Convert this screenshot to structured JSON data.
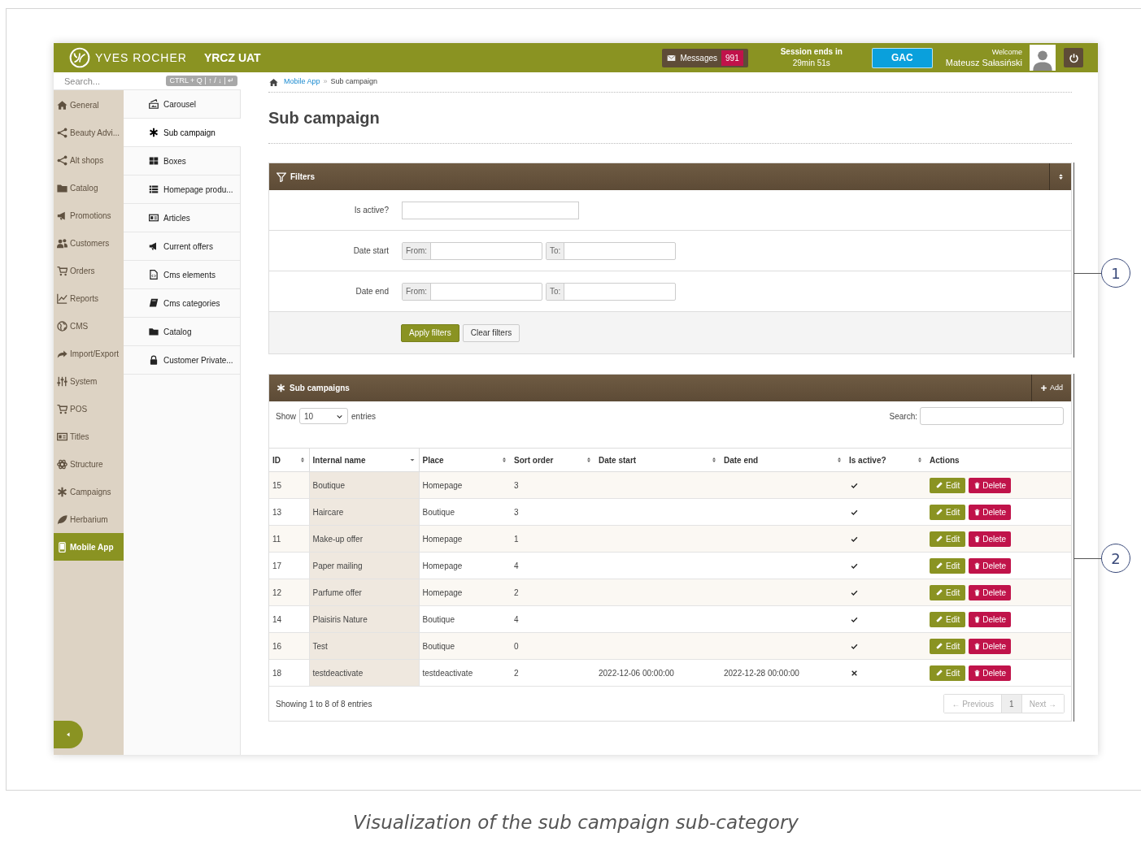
{
  "header": {
    "brand": "YVES ROCHER",
    "env": "YRCZ UAT",
    "messages": {
      "label": "Messages",
      "count": "991"
    },
    "session": {
      "label": "Session ends in",
      "time": "29min 51s"
    },
    "gac": "GAC",
    "welcome": "Welcome",
    "user": "Mateusz Sałasiński"
  },
  "search": {
    "placeholder": "Search...",
    "shortcut": "CTRL + Q | ↑ / ↓ | ↵"
  },
  "sidebar": {
    "items": [
      {
        "label": "General",
        "selected": false
      },
      {
        "label": "Beauty Advi...",
        "selected": false
      },
      {
        "label": "Alt shops",
        "selected": false
      },
      {
        "label": "Catalog",
        "selected": false
      },
      {
        "label": "Promotions",
        "selected": false
      },
      {
        "label": "Customers",
        "selected": false
      },
      {
        "label": "Orders",
        "selected": false
      },
      {
        "label": "Reports",
        "selected": false
      },
      {
        "label": "CMS",
        "selected": false
      },
      {
        "label": "Import/Export",
        "selected": false
      },
      {
        "label": "System",
        "selected": false
      },
      {
        "label": "POS",
        "selected": false
      },
      {
        "label": "Titles",
        "selected": false
      },
      {
        "label": "Structure",
        "selected": false
      },
      {
        "label": "Campaigns",
        "selected": false
      },
      {
        "label": "Herbarium",
        "selected": false
      },
      {
        "label": "Mobile App",
        "selected": true
      }
    ]
  },
  "submenu": {
    "items": [
      {
        "label": "Carousel",
        "selected": false
      },
      {
        "label": "Sub campaign",
        "selected": true
      },
      {
        "label": "Boxes",
        "selected": false
      },
      {
        "label": "Homepage produ...",
        "selected": false
      },
      {
        "label": "Articles",
        "selected": false
      },
      {
        "label": "Current offers",
        "selected": false
      },
      {
        "label": "Cms elements",
        "selected": false
      },
      {
        "label": "Cms categories",
        "selected": false
      },
      {
        "label": "Catalog",
        "selected": false
      },
      {
        "label": "Customer Private...",
        "selected": false
      }
    ]
  },
  "breadcrumb": {
    "items": [
      "Mobile App",
      "Sub campaign"
    ],
    "separator": "»"
  },
  "page_title": "Sub campaign",
  "filters": {
    "title": "Filters",
    "fields": [
      {
        "label": "Is active?",
        "kind": "text"
      },
      {
        "label": "Date start",
        "kind": "range",
        "from": "From:",
        "to": "To:"
      },
      {
        "label": "Date end",
        "kind": "range",
        "from": "From:",
        "to": "To:"
      }
    ],
    "apply": "Apply filters",
    "clear": "Clear filters"
  },
  "table_panel": {
    "title": "Sub campaigns",
    "add": "Add",
    "show": "Show",
    "page_size": "10",
    "entries": "entries",
    "search": "Search:",
    "columns": [
      {
        "label": "ID",
        "sortable": true,
        "sorted": false
      },
      {
        "label": "Internal name",
        "sortable": true,
        "sorted": true
      },
      {
        "label": "Place",
        "sortable": true,
        "sorted": false
      },
      {
        "label": "Sort order",
        "sortable": true,
        "sorted": false
      },
      {
        "label": "Date start",
        "sortable": true,
        "sorted": false
      },
      {
        "label": "Date end",
        "sortable": true,
        "sorted": false
      },
      {
        "label": "Is active?",
        "sortable": true,
        "sorted": false
      },
      {
        "label": "Actions",
        "sortable": false,
        "sorted": false
      }
    ],
    "rows": [
      {
        "id": "15",
        "name": "Boutique",
        "place": "Homepage",
        "sort": "3",
        "active": true,
        "edit": "Edit",
        "delete": "Delete"
      },
      {
        "id": "13",
        "name": "Haircare",
        "place": "Boutique",
        "sort": "3",
        "active": true,
        "edit": "Edit",
        "delete": "Delete"
      },
      {
        "id": "11",
        "name": "Make-up offer",
        "place": "Homepage",
        "sort": "1",
        "active": true,
        "edit": "Edit",
        "delete": "Delete"
      },
      {
        "id": "17",
        "name": "Paper mailing",
        "place": "Homepage",
        "sort": "4",
        "active": true,
        "edit": "Edit",
        "delete": "Delete"
      },
      {
        "id": "12",
        "name": "Parfume offer",
        "place": "Homepage",
        "sort": "2",
        "active": true,
        "edit": "Edit",
        "delete": "Delete"
      },
      {
        "id": "14",
        "name": "Plaisiris Nature",
        "place": "Boutique",
        "sort": "4",
        "active": true,
        "edit": "Edit",
        "delete": "Delete"
      },
      {
        "id": "16",
        "name": "Test",
        "place": "Boutique",
        "sort": "0",
        "active": true,
        "edit": "Edit",
        "delete": "Delete"
      },
      {
        "id": "18",
        "name": "testdeactivate",
        "place": "testdeactivate",
        "sort": "2",
        "start": "2022-12-06 00:00:00",
        "end": "2022-12-28 00:00:00",
        "active": false,
        "edit": "Edit",
        "delete": "Delete"
      }
    ],
    "info": "Showing 1 to 8 of 8 entries",
    "pagination": [
      {
        "label": "← Previous",
        "selected": false,
        "disabled": true
      },
      {
        "label": "1",
        "selected": true,
        "disabled": false
      },
      {
        "label": "Next →",
        "selected": false,
        "disabled": true
      }
    ]
  },
  "callouts": [
    "1",
    "2"
  ],
  "caption": "Visualization of the sub campaign sub-category"
}
